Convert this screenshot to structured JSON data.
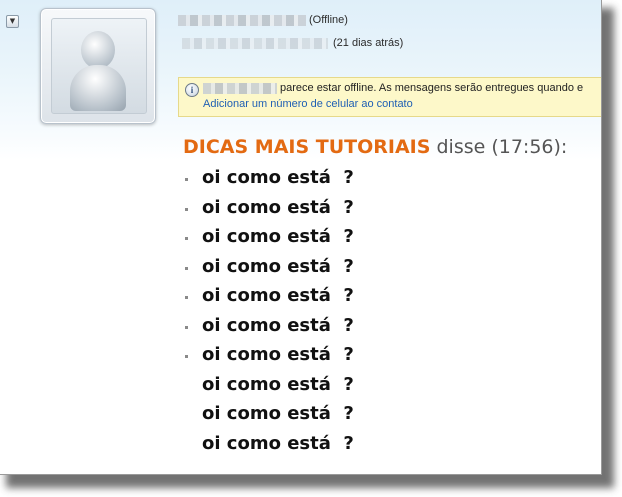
{
  "header": {
    "contact_status": "(Offline)",
    "last_seen": "(21 dias atrás)",
    "collapse_icon": "chevron-down-icon"
  },
  "avatar": {
    "icon": "default-user-icon"
  },
  "info_bar": {
    "icon": "info-icon",
    "message": "parece estar offline. As mensagens serão entregues quando e",
    "link": "Adicionar um número de celular ao contato"
  },
  "conversation": {
    "sender": "DICAS MAIS TUTORIAIS",
    "said": " disse (17:56):",
    "messages": [
      {
        "text": "oi como está  ?",
        "bullet": true
      },
      {
        "text": "oi como está  ?",
        "bullet": true
      },
      {
        "text": "oi como está  ?",
        "bullet": true
      },
      {
        "text": "oi como está  ?",
        "bullet": true
      },
      {
        "text": "oi como está  ?",
        "bullet": true
      },
      {
        "text": "oi como está  ?",
        "bullet": true
      },
      {
        "text": "oi como está  ?",
        "bullet": true
      },
      {
        "text": "oi como está  ?",
        "bullet": false
      },
      {
        "text": "oi como está  ?",
        "bullet": false
      },
      {
        "text": "oi como está  ?",
        "bullet": false
      }
    ]
  },
  "colors": {
    "sender": "#e36a12",
    "link": "#1f5fb4",
    "info_bar_bg": "#fdf8c9"
  }
}
